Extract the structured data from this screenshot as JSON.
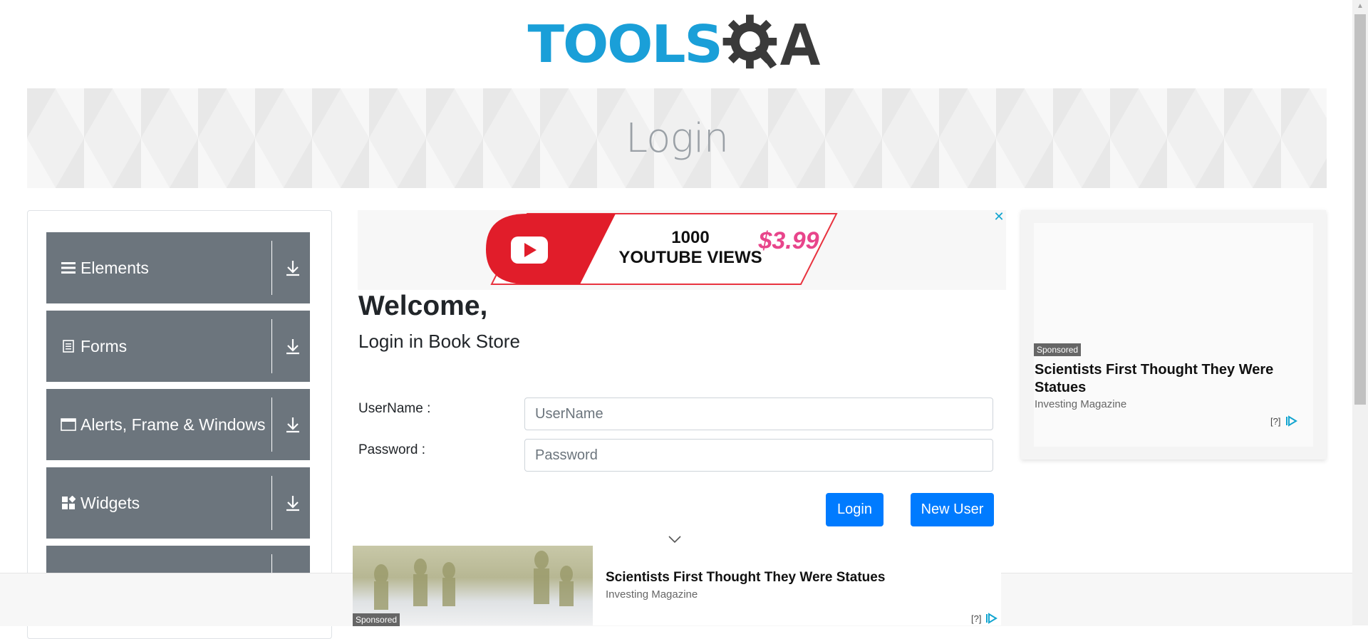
{
  "header": {
    "logo_text": "TOOLS",
    "logo_alt": "ToolsQA logo",
    "brand_color": "#1a9fd8"
  },
  "banner": {
    "title": "Login"
  },
  "sidebar": {
    "groups": [
      {
        "label": "Elements",
        "icon": "hamburger-icon"
      },
      {
        "label": "Forms",
        "icon": "document-icon"
      },
      {
        "label": "Alerts, Frame & Windows",
        "icon": "window-icon"
      },
      {
        "label": "Widgets",
        "icon": "widgets-icon"
      },
      {
        "label": "",
        "icon": ""
      }
    ],
    "collapse_icon": "download-arrow-icon",
    "group_color": "#6c757d"
  },
  "ads": {
    "top_banner": {
      "line1": "1000",
      "line2": "YOUTUBE VIEWS",
      "price": "$3.99",
      "close_icon": "close-icon"
    },
    "right": {
      "sponsored": "Sponsored",
      "headline": "Scientists First Thought They Were Statues",
      "source": "Investing Magazine",
      "info": "[?]"
    },
    "bottom": {
      "sponsored": "Sponsored",
      "headline": "Scientists First Thought They Were Statues",
      "source": "Investing Magazine",
      "info": "[?]"
    }
  },
  "login": {
    "welcome": "Welcome,",
    "subtitle": "Login in Book Store",
    "username_label": "UserName :",
    "username_placeholder": "UserName",
    "password_label": "Password :",
    "password_placeholder": "Password",
    "login_button": "Login",
    "new_user_button": "New User",
    "accent_color": "#007bff"
  }
}
